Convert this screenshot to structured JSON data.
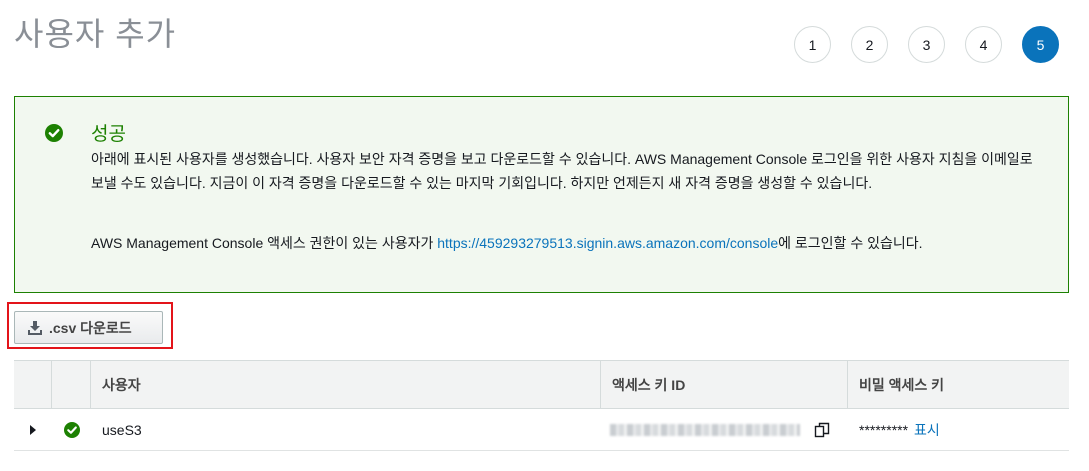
{
  "page": {
    "title": "사용자 추가"
  },
  "steps": [
    {
      "label": "1",
      "active": false
    },
    {
      "label": "2",
      "active": false
    },
    {
      "label": "3",
      "active": false
    },
    {
      "label": "4",
      "active": false
    },
    {
      "label": "5",
      "active": true
    }
  ],
  "success": {
    "title": "성공",
    "message": "아래에 표시된 사용자를 생성했습니다. 사용자 보안 자격 증명을 보고 다운로드할 수 있습니다. AWS Management Console 로그인을 위한 사용자 지침을 이메일로 보낼 수도 있습니다. 지금이 이 자격 증명을 다운로드할 수 있는 마지막 기회입니다. 하지만 언제든지 새 자격 증명을 생성할 수 있습니다.",
    "console_prefix": "AWS Management Console 액세스 권한이 있는 사용자가 ",
    "console_link": "https://459293279513.signin.aws.amazon.com/console",
    "console_suffix": "에 로그인할 수 있습니다."
  },
  "download_button": {
    "label": ".csv 다운로드"
  },
  "table": {
    "headers": {
      "user": "사용자",
      "access_key": "액세스 키 ID",
      "secret_key": "비밀 액세스 키"
    },
    "rows": [
      {
        "user": "useS3",
        "secret_masked": "*********",
        "show_label": "표시"
      }
    ]
  },
  "colors": {
    "accent": "#0a73bb",
    "success": "#1d8102",
    "highlight": "#e3141a"
  }
}
